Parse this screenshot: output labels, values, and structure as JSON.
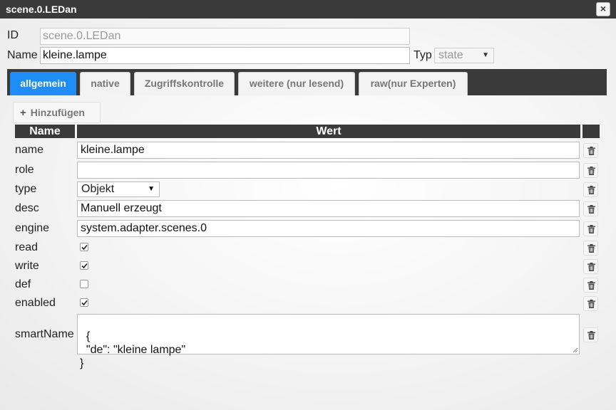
{
  "window": {
    "title": "scene.0.LEDan",
    "close_glyph": "×"
  },
  "header": {
    "id_label": "ID",
    "id_value": "scene.0.LEDan",
    "name_label": "Name",
    "name_value": "kleine.lampe",
    "typ_label": "Typ",
    "typ_value": "state"
  },
  "tabs": [
    {
      "label": "allgemein",
      "active": true
    },
    {
      "label": "native",
      "active": false
    },
    {
      "label": "Zugriffskontrolle",
      "active": false
    },
    {
      "label": "weitere (nur lesend)",
      "active": false
    },
    {
      "label": "raw(nur Experten)",
      "active": false
    }
  ],
  "toolbar": {
    "add_label": "Hinzufügen",
    "add_icon": "plus-icon"
  },
  "table": {
    "headers": [
      "Name",
      "Wert"
    ],
    "rows": [
      {
        "name": "name",
        "kind": "text",
        "value": "kleine.lampe"
      },
      {
        "name": "role",
        "kind": "text",
        "value": ""
      },
      {
        "name": "type",
        "kind": "select",
        "value": "Objekt"
      },
      {
        "name": "desc",
        "kind": "text",
        "value": "Manuell erzeugt"
      },
      {
        "name": "engine",
        "kind": "text",
        "value": "system.adapter.scenes.0"
      },
      {
        "name": "read",
        "kind": "checkbox",
        "checked": true
      },
      {
        "name": "write",
        "kind": "checkbox",
        "checked": true
      },
      {
        "name": "def",
        "kind": "checkbox",
        "checked": false
      },
      {
        "name": "enabled",
        "kind": "checkbox",
        "checked": true
      },
      {
        "name": "smartName",
        "kind": "json",
        "value": "{\n  \"de\": \"kleine lampe\"\n}"
      }
    ],
    "delete_icon": "trash-icon"
  },
  "colors": {
    "accent": "#1e8df5",
    "bar": "#3a3a3a"
  }
}
